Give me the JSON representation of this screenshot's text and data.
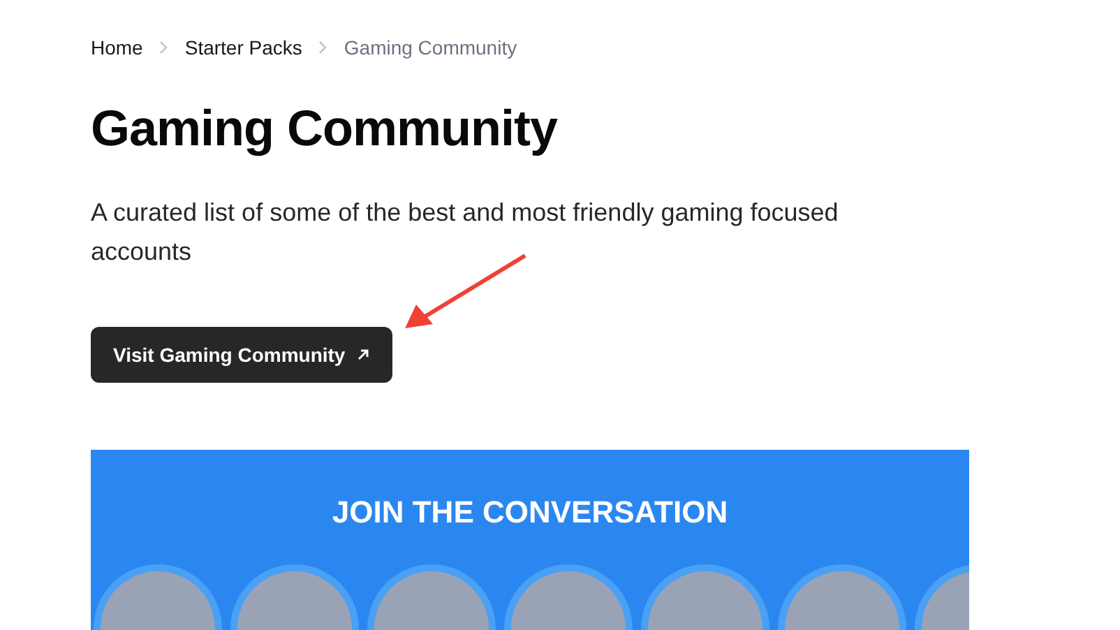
{
  "breadcrumb": [
    {
      "label": "Home",
      "current": false
    },
    {
      "label": "Starter Packs",
      "current": false
    },
    {
      "label": "Gaming Community",
      "current": true
    }
  ],
  "title": "Gaming Community",
  "description": "A curated list of some of the best and most friendly gaming focused accounts",
  "visit_button": {
    "label": "Visit Gaming Community"
  },
  "banner": {
    "heading": "JOIN THE CONVERSATION"
  }
}
